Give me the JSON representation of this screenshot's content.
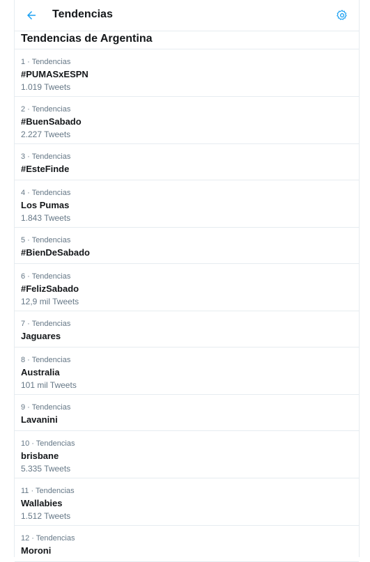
{
  "header": {
    "title": "Tendencias"
  },
  "section": {
    "title": "Tendencias de Argentina"
  },
  "trends": [
    {
      "meta": "1 · Tendencias",
      "name": "#PUMASxESPN",
      "count": "1.019 Tweets"
    },
    {
      "meta": "2 · Tendencias",
      "name": "#BuenSabado",
      "count": "2.227 Tweets"
    },
    {
      "meta": "3 · Tendencias",
      "name": "#EsteFinde",
      "count": ""
    },
    {
      "meta": "4 · Tendencias",
      "name": "Los Pumas",
      "count": "1.843 Tweets"
    },
    {
      "meta": "5 · Tendencias",
      "name": "#BienDeSabado",
      "count": ""
    },
    {
      "meta": "6 · Tendencias",
      "name": "#FelizSabado",
      "count": "12,9 mil Tweets"
    },
    {
      "meta": "7 · Tendencias",
      "name": "Jaguares",
      "count": ""
    },
    {
      "meta": "8 · Tendencias",
      "name": "Australia",
      "count": "101 mil Tweets"
    },
    {
      "meta": "9 · Tendencias",
      "name": "Lavanini",
      "count": ""
    },
    {
      "meta": "10 · Tendencias",
      "name": "brisbane",
      "count": "5.335 Tweets"
    },
    {
      "meta": "11 · Tendencias",
      "name": "Wallabies",
      "count": "1.512 Tweets"
    },
    {
      "meta": "12 · Tendencias",
      "name": "Moroni",
      "count": ""
    }
  ],
  "icons": {
    "back": "arrow-left-icon",
    "settings": "gear-icon"
  },
  "colors": {
    "accent": "#1da1f2",
    "border": "#e6ecf0",
    "secondary_text": "#657786"
  }
}
